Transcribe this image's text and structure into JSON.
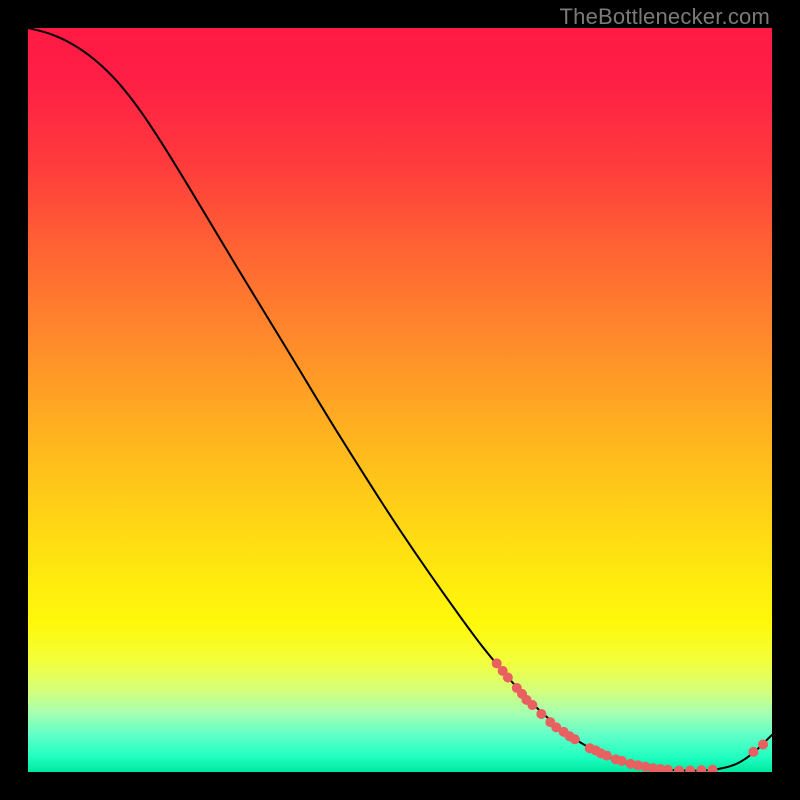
{
  "watermark": "TheBottlenecker.com",
  "chart_data": {
    "type": "line",
    "title": "",
    "xlabel": "",
    "ylabel": "",
    "xlim": [
      0,
      100
    ],
    "ylim": [
      0,
      100
    ],
    "grid": false,
    "line_color": "#000000",
    "point_color": "#e86060",
    "background_gradient": [
      {
        "offset": 0.0,
        "color": "#ff1a44"
      },
      {
        "offset": 0.07,
        "color": "#ff1f45"
      },
      {
        "offset": 0.18,
        "color": "#ff3a3d"
      },
      {
        "offset": 0.3,
        "color": "#ff6433"
      },
      {
        "offset": 0.42,
        "color": "#ff8a2b"
      },
      {
        "offset": 0.55,
        "color": "#ffb41f"
      },
      {
        "offset": 0.67,
        "color": "#ffd714"
      },
      {
        "offset": 0.75,
        "color": "#ffed0e"
      },
      {
        "offset": 0.8,
        "color": "#fff80a"
      },
      {
        "offset": 0.85,
        "color": "#f3ff3a"
      },
      {
        "offset": 0.89,
        "color": "#d6ff7a"
      },
      {
        "offset": 0.92,
        "color": "#a7ffb0"
      },
      {
        "offset": 0.95,
        "color": "#61ffc8"
      },
      {
        "offset": 0.98,
        "color": "#1fffc0"
      },
      {
        "offset": 1.0,
        "color": "#00e8a0"
      }
    ],
    "curve": [
      {
        "x": 0.0,
        "y": 100.0
      },
      {
        "x": 3.0,
        "y": 99.2
      },
      {
        "x": 6.0,
        "y": 97.8
      },
      {
        "x": 9.0,
        "y": 95.7
      },
      {
        "x": 12.0,
        "y": 92.8
      },
      {
        "x": 15.0,
        "y": 89.0
      },
      {
        "x": 18.0,
        "y": 84.5
      },
      {
        "x": 22.0,
        "y": 78.0
      },
      {
        "x": 28.0,
        "y": 68.0
      },
      {
        "x": 35.0,
        "y": 56.5
      },
      {
        "x": 42.0,
        "y": 45.0
      },
      {
        "x": 50.0,
        "y": 32.5
      },
      {
        "x": 58.0,
        "y": 21.0
      },
      {
        "x": 63.0,
        "y": 14.5
      },
      {
        "x": 68.0,
        "y": 9.0
      },
      {
        "x": 73.0,
        "y": 4.8
      },
      {
        "x": 78.0,
        "y": 2.0
      },
      {
        "x": 83.0,
        "y": 0.6
      },
      {
        "x": 88.0,
        "y": 0.2
      },
      {
        "x": 92.0,
        "y": 0.3
      },
      {
        "x": 95.0,
        "y": 1.0
      },
      {
        "x": 97.5,
        "y": 2.6
      },
      {
        "x": 100.0,
        "y": 5.0
      }
    ],
    "points": [
      {
        "x": 63.0,
        "y": 14.6
      },
      {
        "x": 63.8,
        "y": 13.6
      },
      {
        "x": 64.5,
        "y": 12.7
      },
      {
        "x": 65.7,
        "y": 11.3
      },
      {
        "x": 66.4,
        "y": 10.5
      },
      {
        "x": 67.0,
        "y": 9.7
      },
      {
        "x": 67.8,
        "y": 9.0
      },
      {
        "x": 69.0,
        "y": 7.8
      },
      {
        "x": 70.2,
        "y": 6.7
      },
      {
        "x": 71.0,
        "y": 6.0
      },
      {
        "x": 72.0,
        "y": 5.4
      },
      {
        "x": 72.8,
        "y": 4.8
      },
      {
        "x": 73.5,
        "y": 4.4
      },
      {
        "x": 75.5,
        "y": 3.2
      },
      {
        "x": 76.3,
        "y": 2.9
      },
      {
        "x": 77.0,
        "y": 2.5
      },
      {
        "x": 77.8,
        "y": 2.2
      },
      {
        "x": 79.0,
        "y": 1.7
      },
      {
        "x": 79.8,
        "y": 1.5
      },
      {
        "x": 81.0,
        "y": 1.1
      },
      {
        "x": 82.0,
        "y": 0.9
      },
      {
        "x": 83.0,
        "y": 0.7
      },
      {
        "x": 84.0,
        "y": 0.5
      },
      {
        "x": 85.0,
        "y": 0.4
      },
      {
        "x": 86.0,
        "y": 0.3
      },
      {
        "x": 87.5,
        "y": 0.2
      },
      {
        "x": 89.0,
        "y": 0.2
      },
      {
        "x": 90.5,
        "y": 0.25
      },
      {
        "x": 92.0,
        "y": 0.3
      },
      {
        "x": 97.5,
        "y": 2.7
      },
      {
        "x": 98.8,
        "y": 3.7
      }
    ],
    "point_radius": 5
  }
}
